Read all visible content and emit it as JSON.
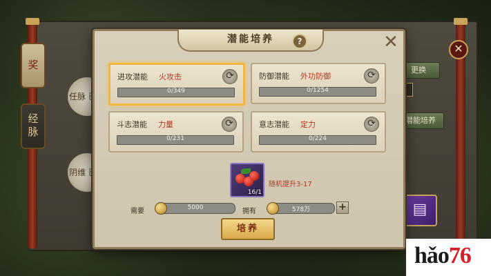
{
  "dialog": {
    "title": "潜能培养",
    "help_glyph": "?",
    "close_glyph": "✕",
    "cards": [
      {
        "label": "进攻潜能",
        "value": "火攻击",
        "progress": "0/349",
        "selected": true
      },
      {
        "label": "防御潜能",
        "value": "外功防御",
        "progress": "0/1254",
        "selected": false
      },
      {
        "label": "斗志潜能",
        "value": "力量",
        "progress": "0/231",
        "selected": false
      },
      {
        "label": "意志潜能",
        "value": "定力",
        "progress": "0/224",
        "selected": false
      }
    ],
    "item": {
      "count": "16/1",
      "description": "随机提升3-17"
    },
    "cost": {
      "need_label": "需要",
      "need_value": "5000",
      "own_label": "拥有",
      "own_value": "578万",
      "plus_glyph": "+"
    },
    "train_button": "培养"
  },
  "background": {
    "side_tabs": [
      "奖",
      "经脉",
      "经"
    ],
    "circle_texts": [
      "任脉 已开",
      "阴维 已开"
    ],
    "right_buttons": [
      "更换",
      "潜能培养"
    ],
    "close_glyph": "✕",
    "book_glyph": "▤"
  },
  "logo": {
    "prefix": "hǎo",
    "suffix": "76"
  }
}
